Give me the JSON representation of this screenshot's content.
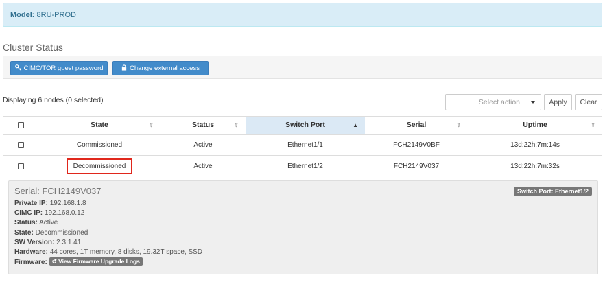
{
  "model": {
    "label": "Model:",
    "value": "8RU-PROD"
  },
  "cluster": {
    "title": "Cluster Status"
  },
  "buttons": {
    "guest_password": "CIMC/TOR guest password",
    "external_access": "Change external access"
  },
  "toolbar": {
    "displaying": "Displaying 6 nodes (0 selected)",
    "select_placeholder": "Select action",
    "apply": "Apply",
    "clear": "Clear"
  },
  "table": {
    "headers": [
      "State",
      "Status",
      "Switch Port",
      "Serial",
      "Uptime"
    ],
    "sorted_column": "Switch Port",
    "rows": [
      {
        "state": "Commissioned",
        "status": "Active",
        "switch_port": "Ethernet1/1",
        "serial": "FCH2149V0BF",
        "uptime": "13d:22h:7m:14s"
      },
      {
        "state": "Decommissioned",
        "status": "Active",
        "switch_port": "Ethernet1/2",
        "serial": "FCH2149V037",
        "uptime": "13d:22h:7m:32s"
      }
    ]
  },
  "detail": {
    "serial": "Serial: FCH2149V037",
    "badge": "Switch Port: Ethernet1/2",
    "private_ip": {
      "label": "Private IP:",
      "value": "192.168.1.8"
    },
    "cimc_ip": {
      "label": "CIMC IP:",
      "value": "192.168.0.12"
    },
    "status": {
      "label": "Status:",
      "value": "Active"
    },
    "state": {
      "label": "State:",
      "value": "Decommissioned"
    },
    "sw_version": {
      "label": "SW Version:",
      "value": "2.3.1.41"
    },
    "hardware": {
      "label": "Hardware:",
      "value": "44 cores, 1T memory, 8 disks, 19.32T space, SSD"
    },
    "firmware": {
      "label": "Firmware:",
      "button": "View Firmware Upgrade Logs"
    }
  },
  "colors": {
    "primary": "#428bca",
    "info_bg": "#d9edf7",
    "highlight": "#e0271c",
    "badge": "#777777"
  },
  "icons": {
    "guest_password": "key-icon",
    "external_access": "lock-icon",
    "firmware": "history-icon"
  }
}
